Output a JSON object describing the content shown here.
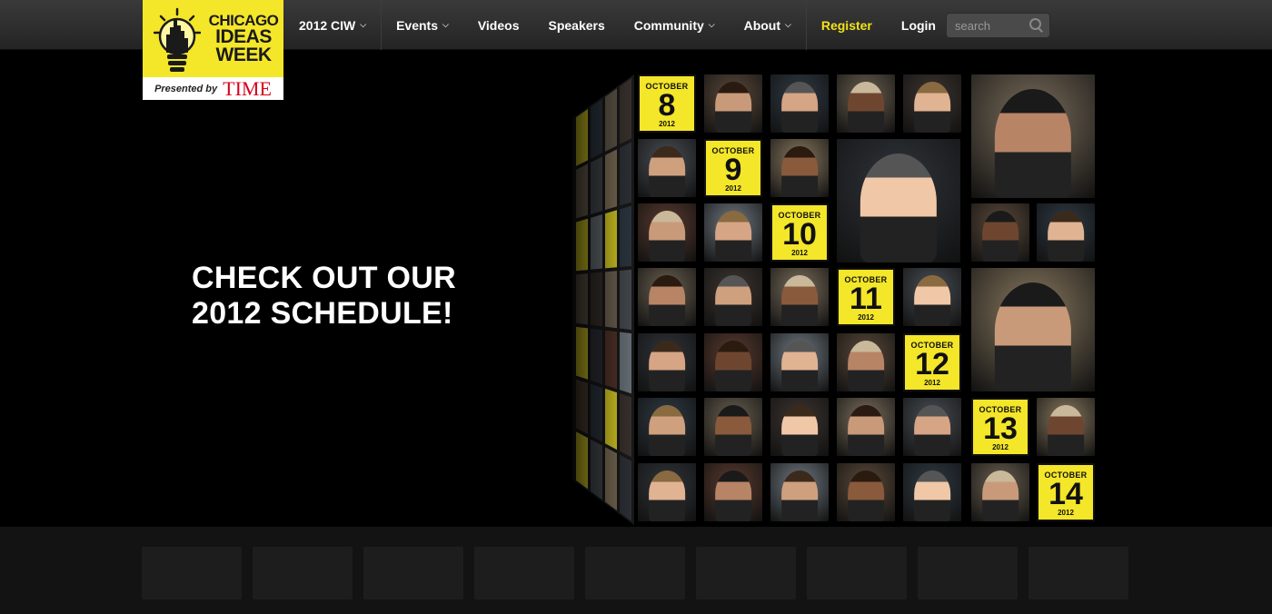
{
  "logo": {
    "name_line1": "CHICAGO",
    "name_line2": "IDEAS",
    "name_line3": "WEEK",
    "presented_by": "Presented by",
    "sponsor": "TIME"
  },
  "nav": {
    "items": [
      {
        "label": "2012 CIW",
        "dropdown": true
      },
      {
        "label": "Events",
        "dropdown": true
      },
      {
        "label": "Videos",
        "dropdown": false
      },
      {
        "label": "Speakers",
        "dropdown": false
      },
      {
        "label": "Community",
        "dropdown": true
      },
      {
        "label": "About",
        "dropdown": true
      }
    ],
    "register_label": "Register",
    "login_label": "Login",
    "search_placeholder": "search",
    "caret": "⌵"
  },
  "hero": {
    "headline_line1": "CHECK OUT OUR",
    "headline_line2": "2012 SCHEDULE!"
  },
  "schedule_dates": [
    {
      "month": "OCTOBER",
      "day": "8",
      "year": "2012"
    },
    {
      "month": "OCTOBER",
      "day": "9",
      "year": "2012"
    },
    {
      "month": "OCTOBER",
      "day": "10",
      "year": "2012"
    },
    {
      "month": "OCTOBER",
      "day": "11",
      "year": "2012"
    },
    {
      "month": "OCTOBER",
      "day": "12",
      "year": "2012"
    },
    {
      "month": "OCTOBER",
      "day": "13",
      "year": "2012"
    },
    {
      "month": "OCTOBER",
      "day": "14",
      "year": "2012"
    }
  ],
  "colors": {
    "brand_yellow": "#f4e629",
    "register": "#f2e31a",
    "time_red": "#d6001c"
  },
  "footer": {
    "thumbnail_count": 9
  }
}
